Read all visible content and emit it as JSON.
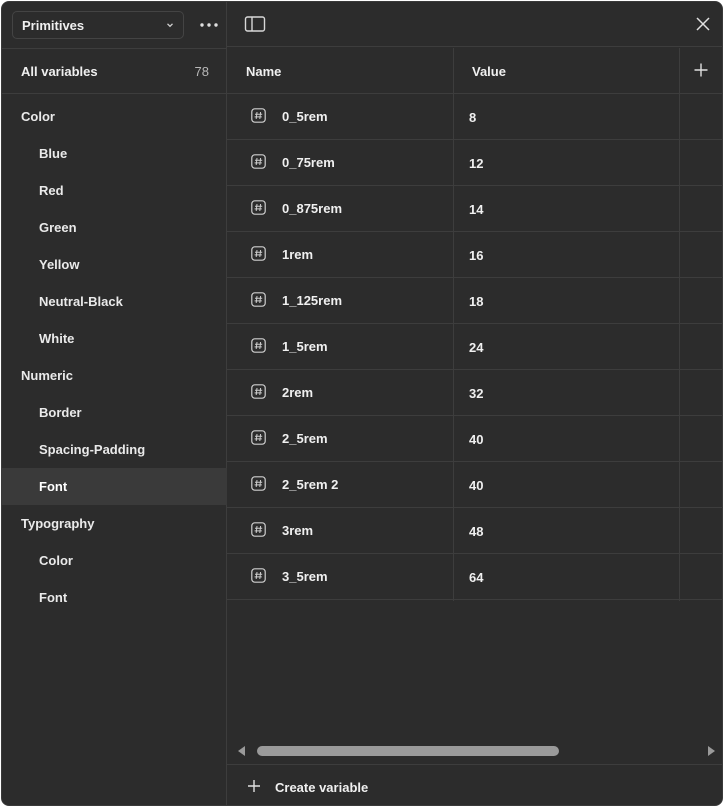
{
  "sidebar": {
    "collection": "Primitives",
    "all_variables_label": "All variables",
    "all_variables_count": "78",
    "groups": [
      {
        "label": "Color",
        "level": 0
      },
      {
        "label": "Blue",
        "level": 1
      },
      {
        "label": "Red",
        "level": 1
      },
      {
        "label": "Green",
        "level": 1
      },
      {
        "label": "Yellow",
        "level": 1
      },
      {
        "label": "Neutral-Black",
        "level": 1
      },
      {
        "label": "White",
        "level": 1
      },
      {
        "label": "Numeric",
        "level": 0
      },
      {
        "label": "Border",
        "level": 1
      },
      {
        "label": "Spacing-Padding",
        "level": 1
      },
      {
        "label": "Font",
        "level": 1,
        "active": true
      },
      {
        "label": "Typography",
        "level": 0
      },
      {
        "label": "Color",
        "level": 1
      },
      {
        "label": "Font",
        "level": 1
      }
    ]
  },
  "table": {
    "col_name": "Name",
    "col_value": "Value",
    "rows": [
      {
        "name": "0_5rem",
        "value": "8"
      },
      {
        "name": "0_75rem",
        "value": "12"
      },
      {
        "name": "0_875rem",
        "value": "14"
      },
      {
        "name": "1rem",
        "value": "16"
      },
      {
        "name": "1_125rem",
        "value": "18"
      },
      {
        "name": "1_5rem",
        "value": "24"
      },
      {
        "name": "2rem",
        "value": "32"
      },
      {
        "name": "2_5rem",
        "value": "40"
      },
      {
        "name": "2_5rem 2",
        "value": "40"
      },
      {
        "name": "3rem",
        "value": "48"
      },
      {
        "name": "3_5rem",
        "value": "64"
      }
    ]
  },
  "footer": {
    "create_label": "Create variable"
  },
  "icons": {
    "more": "more-horizontal-icon",
    "toggle": "sidebar-toggle-icon",
    "close": "close-icon",
    "add_column": "plus-icon",
    "variable_type": "number-hash-icon"
  }
}
